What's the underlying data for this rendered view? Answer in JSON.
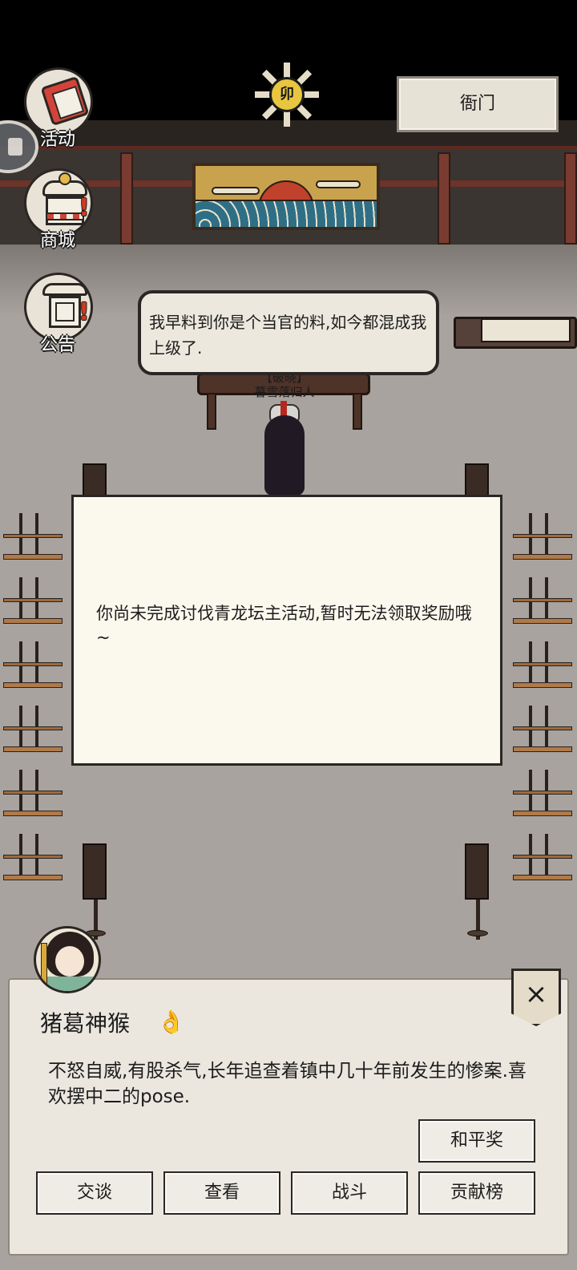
{
  "hud": {
    "activity_label": "活动",
    "shop_label": "商城",
    "notice_label": "公告",
    "yamen_label": "衙门",
    "time_glyph": "卯"
  },
  "speech": {
    "text": "我早料到你是个当官的料,如今都混成我上级了."
  },
  "scene": {
    "character_title": "【破晓】",
    "character_name": "暮雪落归人"
  },
  "modal": {
    "message": "你尚未完成讨伐青龙坛主活动,暂时无法领取奖励哦~"
  },
  "npc": {
    "name": "猪葛神猴",
    "name_icon": "👌",
    "description": "不怒自威,有股杀气,长年追查着镇中几十年前发生的惨案.喜欢摆中二的pose.",
    "close_symbol": "×",
    "actions": {
      "peace_prize": "和平奖",
      "talk": "交谈",
      "view": "查看",
      "fight": "战斗",
      "contribution": "贡献榜"
    }
  }
}
